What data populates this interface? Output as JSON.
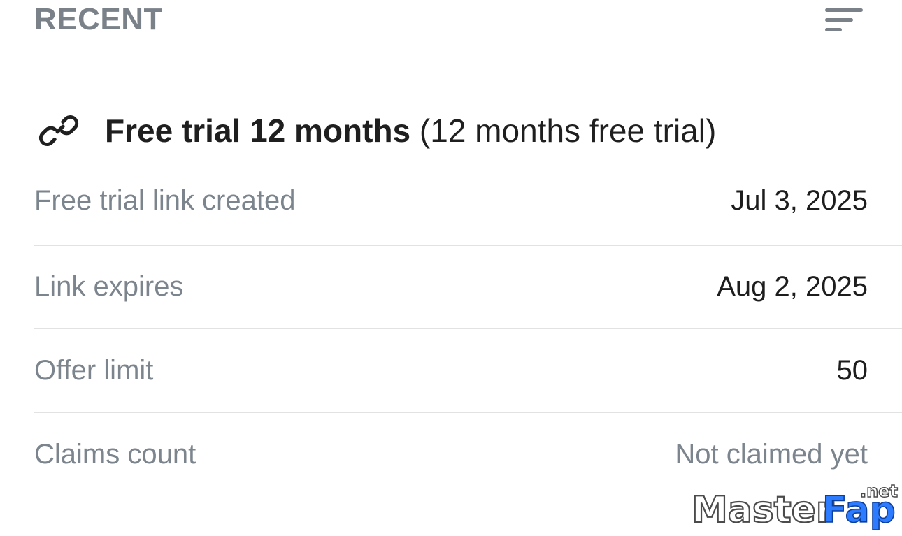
{
  "header": {
    "title": "RECENT",
    "filter_icon": "filter-icon"
  },
  "offer": {
    "icon": "link-icon",
    "name": "Free trial 12 months",
    "subtitle": "(12 months free trial)"
  },
  "details": [
    {
      "label": "Free trial link created",
      "value": "Jul 3, 2025"
    },
    {
      "label": "Link expires",
      "value": "Aug 2, 2025"
    },
    {
      "label": "Offer limit",
      "value": "50"
    },
    {
      "label": "Claims count",
      "value": "Not claimed yet"
    }
  ],
  "watermark": {
    "text": "MasterFap",
    "tld": ".net"
  },
  "colors": {
    "heading": "#7a8188",
    "label": "#7c858d",
    "value": "#1d1d1d",
    "divider": "#e2e2e2",
    "watermark_blue": "#2d7bff"
  }
}
